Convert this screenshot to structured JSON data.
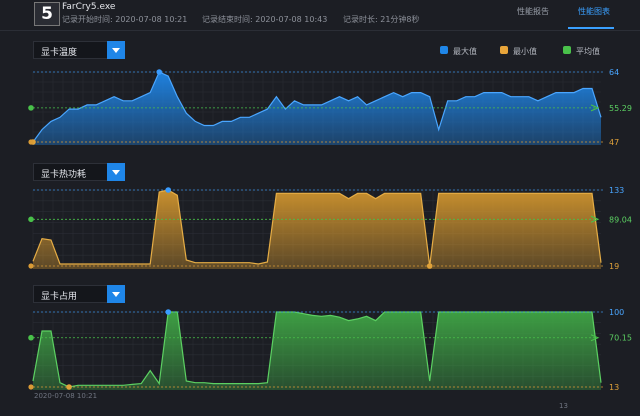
{
  "header": {
    "app_icon_text": "5",
    "exe_name": "FarCry5.exe",
    "start_label": "记录开始时间: 2020-07-08 10:21",
    "end_label": "记录结束时间: 2020-07-08 10:43",
    "duration_label": "记录时长: 21分钟8秒",
    "tabs": [
      {
        "label": "性能报告",
        "active": false
      },
      {
        "label": "性能图表",
        "active": true
      }
    ]
  },
  "legend": [
    {
      "label": "最大值",
      "color": "#1f86e8"
    },
    {
      "label": "最小值",
      "color": "#e8a53a"
    },
    {
      "label": "平均值",
      "color": "#49c14a"
    }
  ],
  "charts": [
    {
      "selector": "显卡温度",
      "max": "64",
      "avg": "55.29",
      "min": "47",
      "fill": "#1f86e8",
      "line": "#4aa6ff"
    },
    {
      "selector": "显卡热功耗",
      "max": "133",
      "avg": "89.04",
      "min": "19",
      "fill": "#d1952e",
      "line": "#e6ad45"
    },
    {
      "selector": "显卡占用",
      "max": "100",
      "avg": "70.15",
      "min": "13",
      "fill": "#3fa545",
      "line": "#5cd062"
    }
  ],
  "chart_data": [
    {
      "type": "area",
      "title": "显卡温度",
      "ylim": [
        47,
        64
      ],
      "average": 55.29,
      "values": [
        47,
        50,
        52,
        53,
        55,
        55,
        56,
        56,
        57,
        58,
        57,
        57,
        58,
        59,
        64,
        63,
        58,
        54,
        52,
        51,
        51,
        52,
        52,
        53,
        53,
        54,
        55,
        58,
        55,
        57,
        56,
        56,
        56,
        57,
        58,
        57,
        58,
        56,
        57,
        58,
        59,
        58,
        59,
        59,
        58,
        50,
        57,
        57,
        58,
        58,
        59,
        59,
        59,
        58,
        58,
        58,
        57,
        58,
        59,
        59,
        59,
        60,
        60,
        53
      ]
    },
    {
      "type": "area",
      "title": "显卡热功耗",
      "ylim": [
        19,
        133
      ],
      "average": 89.04,
      "values": [
        26,
        60,
        58,
        22,
        22,
        22,
        22,
        22,
        22,
        22,
        22,
        22,
        22,
        22,
        130,
        133,
        125,
        28,
        24,
        24,
        24,
        24,
        24,
        24,
        24,
        22,
        25,
        128,
        128,
        128,
        128,
        128,
        128,
        128,
        128,
        120,
        128,
        128,
        120,
        128,
        128,
        128,
        128,
        128,
        19,
        128,
        128,
        128,
        128,
        128,
        128,
        128,
        128,
        128,
        128,
        128,
        128,
        128,
        128,
        128,
        128,
        128,
        128,
        24
      ]
    },
    {
      "type": "area",
      "title": "显卡占用",
      "ylim": [
        13,
        100
      ],
      "average": 70.15,
      "values": [
        20,
        78,
        78,
        18,
        13,
        15,
        15,
        15,
        15,
        15,
        15,
        16,
        17,
        32,
        17,
        100,
        100,
        20,
        18,
        18,
        17,
        17,
        17,
        17,
        17,
        17,
        18,
        100,
        100,
        100,
        98,
        96,
        95,
        96,
        94,
        90,
        92,
        95,
        90,
        100,
        100,
        100,
        100,
        100,
        20,
        100,
        100,
        100,
        100,
        100,
        100,
        100,
        100,
        100,
        100,
        100,
        100,
        100,
        100,
        100,
        100,
        100,
        100,
        18
      ]
    }
  ],
  "footer": {
    "start_time": "2020-07-08 10:21",
    "end_time": "13"
  }
}
